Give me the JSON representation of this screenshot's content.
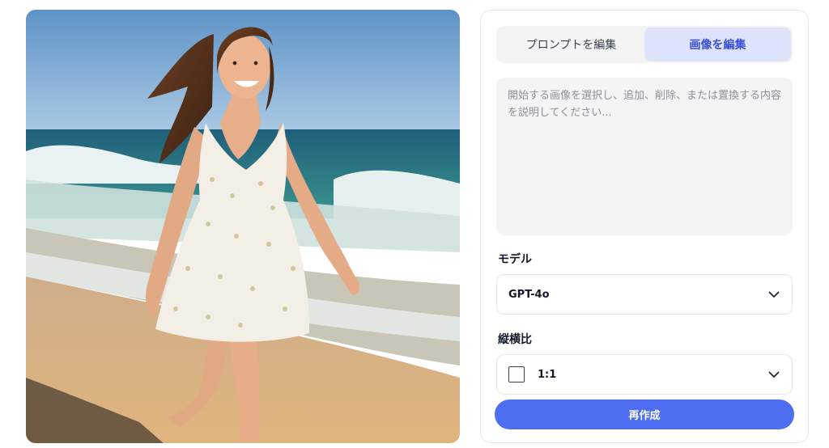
{
  "image": {
    "alt": "",
    "colors": {
      "sky": "#6b9ccc",
      "sea": "#2b7f86",
      "sand": "#d9b286",
      "dress": "#f4efe6"
    }
  },
  "editor": {
    "tabs": [
      {
        "label": "プロンプトを編集",
        "active": false
      },
      {
        "label": "画像を編集",
        "active": true
      }
    ],
    "prompt": {
      "value": "",
      "placeholder": "開始する画像を選択し、追加、削除、または置換する内容を説明してください..."
    },
    "model": {
      "label": "モデル",
      "selected": "GPT-4o",
      "icon": "chevron-down-icon"
    },
    "aspect_ratio": {
      "label": "縦横比",
      "selected": "1:1",
      "icon": "chevron-down-icon"
    },
    "regenerate_label": "再作成",
    "accent_color": "#4e6ef2",
    "active_tab_bg": "#dde3fb"
  }
}
